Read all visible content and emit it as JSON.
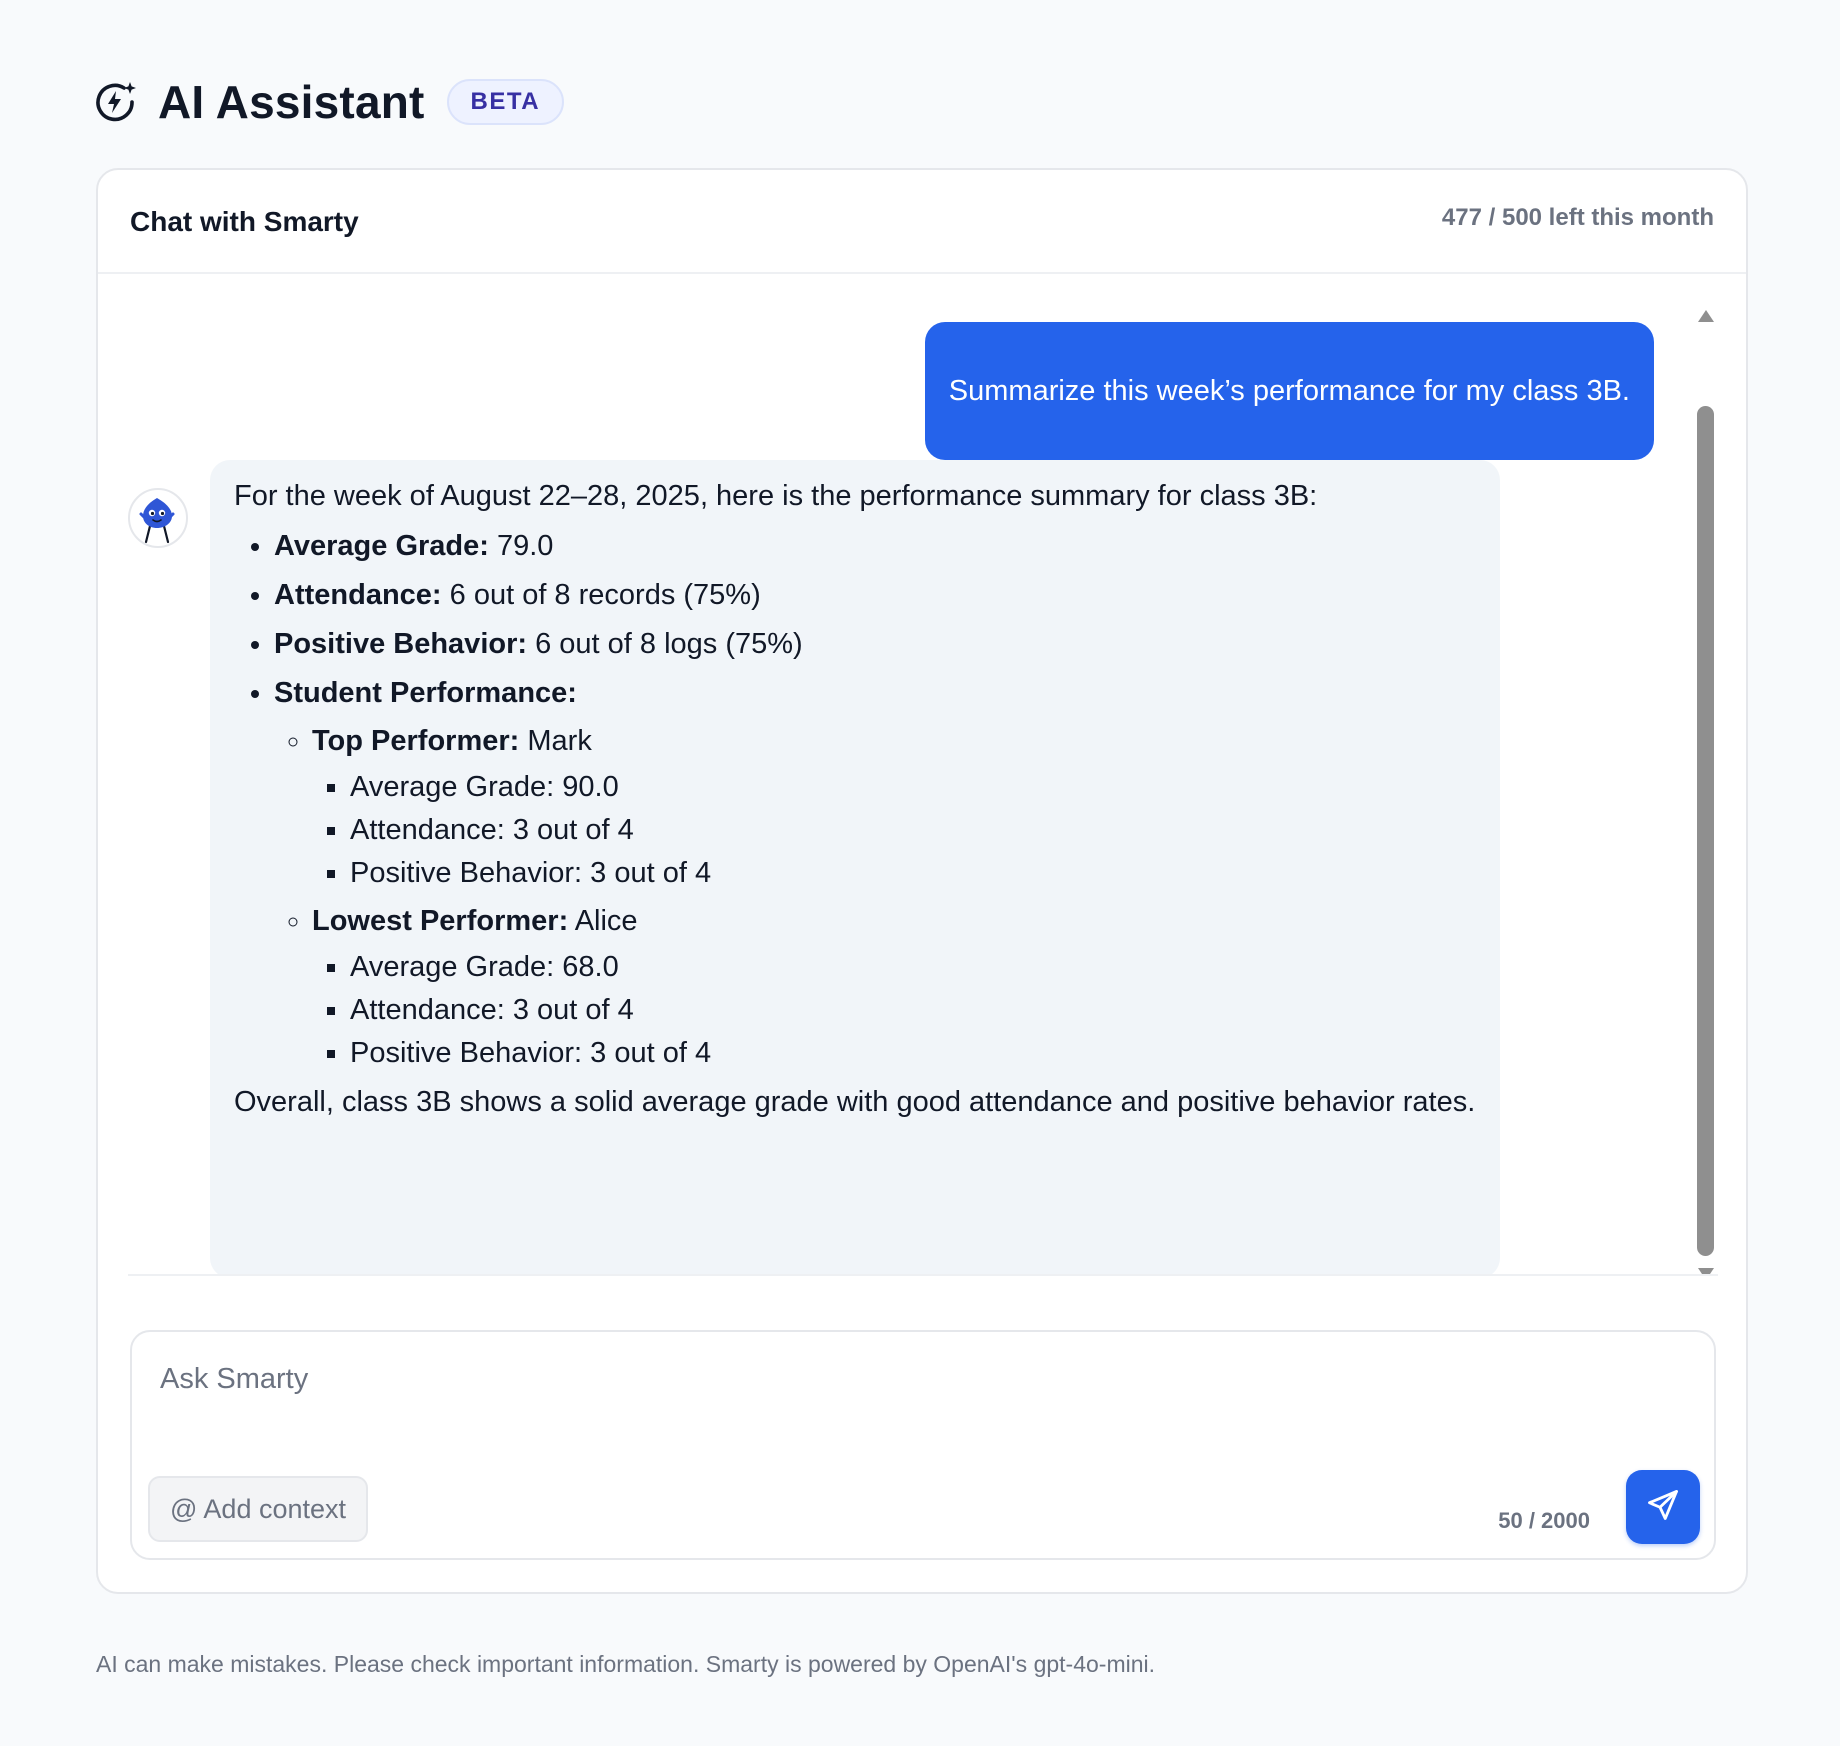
{
  "app": {
    "title": "AI Assistant",
    "badge": "BETA"
  },
  "chat": {
    "title": "Chat with Smarty",
    "quota": "477 / 500 left this month"
  },
  "messages": {
    "user": "Summarize this week’s performance for my class 3B.",
    "assistant": {
      "intro": "For the week of August 22–28, 2025, here is the performance summary for class 3B:",
      "items": [
        {
          "label": "Average Grade:",
          "value": " 79.0"
        },
        {
          "label": "Attendance:",
          "value": " 6 out of 8 records (75%)"
        },
        {
          "label": "Positive Behavior:",
          "value": " 6 out of 8 logs (75%)"
        },
        {
          "label": "Student Performance:",
          "value": ""
        }
      ],
      "students": [
        {
          "label": "Top Performer:",
          "value": " Mark",
          "details": [
            "Average Grade: 90.0",
            "Attendance: 3 out of 4",
            "Positive Behavior: 3 out of 4"
          ]
        },
        {
          "label": "Lowest Performer:",
          "value": " Alice",
          "details": [
            "Average Grade: 68.0",
            "Attendance: 3 out of 4",
            "Positive Behavior: 3 out of 4"
          ]
        }
      ],
      "summary": "Overall, class 3B shows a solid average grade with good attendance and positive behavior rates."
    }
  },
  "composer": {
    "placeholder": "Ask Smarty",
    "add_context": "@ Add context",
    "char_count": "50 / 2000"
  },
  "footer": {
    "disclaimer": "AI can make mistakes. Please check important information. Smarty is powered by OpenAI's gpt-4o-mini."
  },
  "colors": {
    "accent": "#2563eb",
    "background": "#f8fafc",
    "assistant_bubble": "#f1f5f9",
    "badge_text": "#3730a3"
  },
  "icons": {
    "logo": "sparkle-bolt-icon",
    "avatar": "smarty-mascot-icon",
    "send": "send-plane-icon"
  }
}
